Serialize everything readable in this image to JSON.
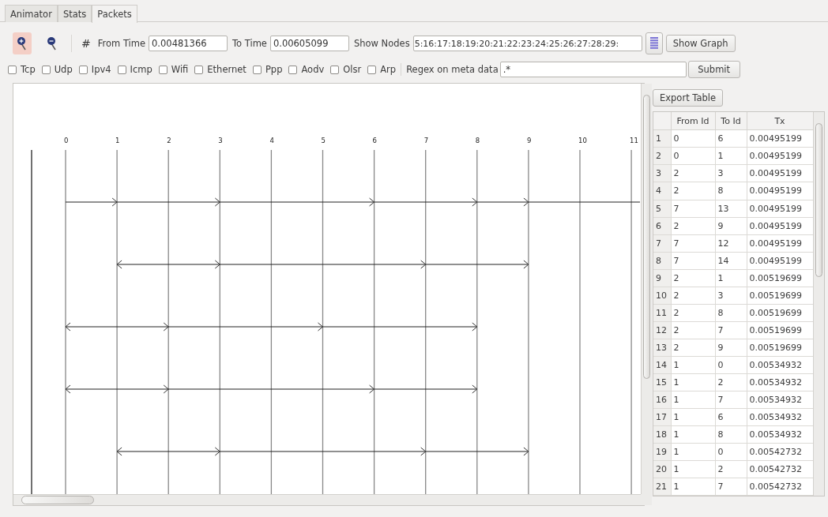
{
  "tabs": [
    {
      "label": "Animator",
      "selected": false
    },
    {
      "label": "Stats",
      "selected": false
    },
    {
      "label": "Packets",
      "selected": true
    }
  ],
  "toolbar": {
    "zoom_buttons": [
      {
        "kind": "zoom-in",
        "selected": true
      },
      {
        "kind": "zoom-out",
        "selected": false
      }
    ],
    "hash_symbol": "#",
    "from_time": {
      "label": "From Time",
      "value": "0.00481366"
    },
    "to_time": {
      "label": "To Time",
      "value": "0.00605099"
    },
    "show_nodes": {
      "label": "Show Nodes",
      "value": "5:16:17:18:19:20:21:22:23:24:25:26:27:28:29:"
    },
    "show_graph_button": "Show Graph"
  },
  "filters": [
    {
      "label": "Tcp",
      "checked": false
    },
    {
      "label": "Udp",
      "checked": false
    },
    {
      "label": "Ipv4",
      "checked": false
    },
    {
      "label": "Icmp",
      "checked": false
    },
    {
      "label": "Wifi",
      "checked": false
    },
    {
      "label": "Ethernet",
      "checked": false
    },
    {
      "label": "Ppp",
      "checked": false
    },
    {
      "label": "Aodv",
      "checked": false
    },
    {
      "label": "Olsr",
      "checked": false
    },
    {
      "label": "Arp",
      "checked": false
    }
  ],
  "regex": {
    "label": "Regex on meta data",
    "value": ".*"
  },
  "submit_button": "Submit",
  "graph": {
    "nodes": [
      "0",
      "1",
      "2",
      "3",
      "4",
      "5",
      "6",
      "7",
      "8",
      "9",
      "10",
      "11"
    ]
  },
  "table": {
    "export_button": "Export Table",
    "columns": [
      "From Id",
      "To Id",
      "Tx"
    ],
    "rows": [
      {
        "number": "1",
        "from": "0",
        "to": "6",
        "tx": "0.00495199"
      },
      {
        "number": "2",
        "from": "0",
        "to": "1",
        "tx": "0.00495199"
      },
      {
        "number": "3",
        "from": "2",
        "to": "3",
        "tx": "0.00495199"
      },
      {
        "number": "4",
        "from": "2",
        "to": "8",
        "tx": "0.00495199"
      },
      {
        "number": "5",
        "from": "7",
        "to": "13",
        "tx": "0.00495199"
      },
      {
        "number": "6",
        "from": "2",
        "to": "9",
        "tx": "0.00495199"
      },
      {
        "number": "7",
        "from": "7",
        "to": "12",
        "tx": "0.00495199"
      },
      {
        "number": "8",
        "from": "7",
        "to": "14",
        "tx": "0.00495199"
      },
      {
        "number": "9",
        "from": "2",
        "to": "1",
        "tx": "0.00519699"
      },
      {
        "number": "10",
        "from": "2",
        "to": "3",
        "tx": "0.00519699"
      },
      {
        "number": "11",
        "from": "2",
        "to": "8",
        "tx": "0.00519699"
      },
      {
        "number": "12",
        "from": "2",
        "to": "7",
        "tx": "0.00519699"
      },
      {
        "number": "13",
        "from": "2",
        "to": "9",
        "tx": "0.00519699"
      },
      {
        "number": "14",
        "from": "1",
        "to": "0",
        "tx": "0.00534932"
      },
      {
        "number": "15",
        "from": "1",
        "to": "2",
        "tx": "0.00534932"
      },
      {
        "number": "16",
        "from": "1",
        "to": "7",
        "tx": "0.00534932"
      },
      {
        "number": "17",
        "from": "1",
        "to": "6",
        "tx": "0.00534932"
      },
      {
        "number": "18",
        "from": "1",
        "to": "8",
        "tx": "0.00534932"
      },
      {
        "number": "19",
        "from": "1",
        "to": "0",
        "tx": "0.00542732"
      },
      {
        "number": "20",
        "from": "1",
        "to": "2",
        "tx": "0.00542732"
      },
      {
        "number": "21",
        "from": "1",
        "to": "7",
        "tx": "0.00542732"
      }
    ]
  }
}
